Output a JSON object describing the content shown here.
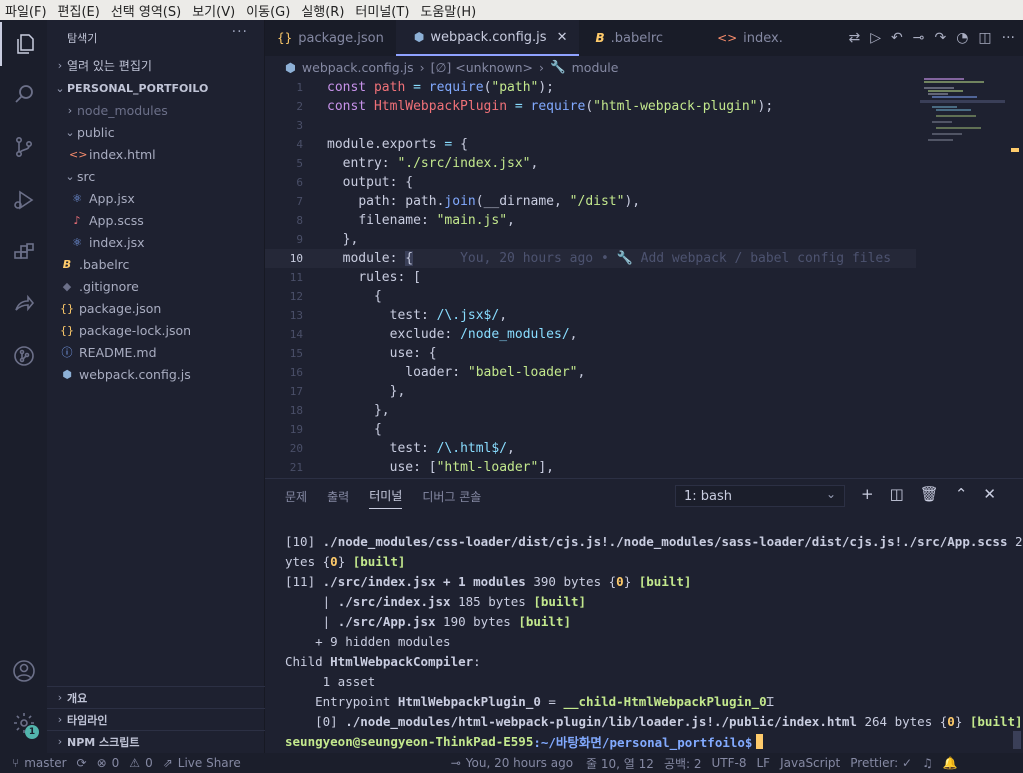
{
  "menu": [
    "파일(F)",
    "편집(E)",
    "선택 영역(S)",
    "보기(V)",
    "이동(G)",
    "실행(R)",
    "터미널(T)",
    "도움말(H)"
  ],
  "sidebar": {
    "title": "탐색기",
    "open_editors": "열려 있는 편집기",
    "project": "PERSONAL_PORTFOILO",
    "tree": [
      {
        "label": "node_modules",
        "icon": "›",
        "muted": true
      },
      {
        "label": "public",
        "icon": "⌄"
      },
      {
        "label": "index.html",
        "icon": "<>"
      },
      {
        "label": "src",
        "icon": "⌄"
      },
      {
        "label": "App.jsx",
        "icon": "⚛"
      },
      {
        "label": "App.scss",
        "icon": "♪"
      },
      {
        "label": "index.jsx",
        "icon": "⚛"
      },
      {
        "label": ".babelrc",
        "icon": "B"
      },
      {
        "label": ".gitignore",
        "icon": "◆"
      },
      {
        "label": "package.json",
        "icon": "{}"
      },
      {
        "label": "package-lock.json",
        "icon": "{}"
      },
      {
        "label": "README.md",
        "icon": "ⓘ"
      },
      {
        "label": "webpack.config.js",
        "icon": "⬢"
      }
    ],
    "bottom": [
      "개요",
      "타임라인",
      "NPM 스크립트"
    ],
    "badge": "1"
  },
  "tabs": [
    {
      "label": "package.json",
      "icon": "{}",
      "color": "#ffcb6b"
    },
    {
      "label": "webpack.config.js",
      "icon": "⬢",
      "color": "#8db0d6",
      "active": true
    },
    {
      "label": ".babelrc",
      "icon": "B",
      "color": "#ffcb6b"
    },
    {
      "label": "index.",
      "icon": "<>",
      "color": "#f78c6c"
    }
  ],
  "breadcrumb": [
    "webpack.config.js",
    "›",
    "[∅] <unknown>",
    "›",
    "module"
  ],
  "code_annotation": "You, 20 hours ago • 🔧 Add webpack / babel config files",
  "panel": {
    "tabs": [
      "문제",
      "출력",
      "터미널",
      "디버그 콘솔"
    ],
    "active_tab": "터미널",
    "terminal_select": "1: bash",
    "prompt_user": "seungyeon@seungyeon-ThinkPad-E595",
    "prompt_path": ":~/바탕화면/personal_portfoilo$"
  },
  "status": {
    "branch": "master",
    "errors": "0",
    "warnings": "0",
    "liveshare": "Live Share",
    "blame": "You, 20 hours ago",
    "position": "줄 10, 열 12",
    "spaces": "공백: 2",
    "encoding": "UTF-8",
    "eol": "LF",
    "language": "JavaScript",
    "prettier": "Prettier: ✓"
  }
}
